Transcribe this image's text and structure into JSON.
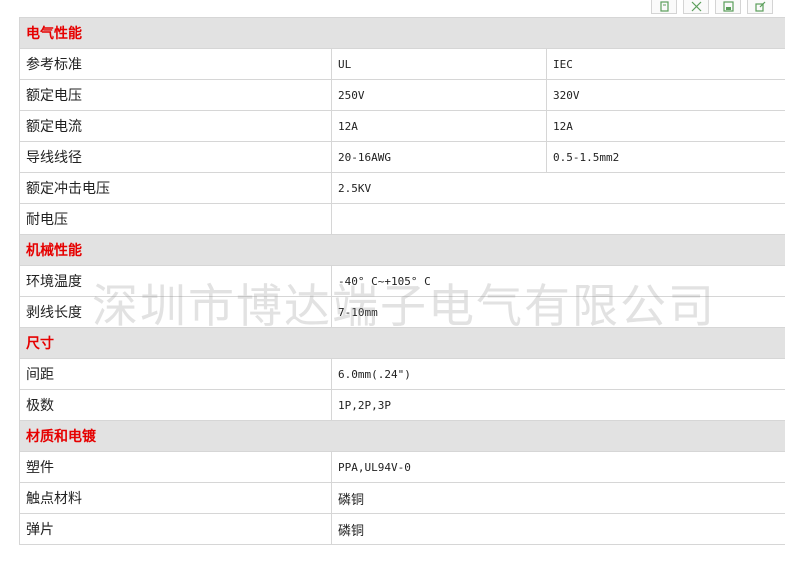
{
  "colors": {
    "section_text": "#e60000",
    "section_bg": "#e2e2e2",
    "border": "#d6d6d6"
  },
  "toolbar": {
    "icons": [
      "copy-icon",
      "expand-icon",
      "save-icon",
      "export-icon"
    ]
  },
  "table": {
    "sections": [
      {
        "title": "电气性能",
        "rows": [
          {
            "label": "参考标准",
            "values": [
              "UL",
              "IEC"
            ]
          },
          {
            "label": "额定电压",
            "values": [
              "250V",
              "320V"
            ]
          },
          {
            "label": "额定电流",
            "values": [
              "12A",
              "12A"
            ]
          },
          {
            "label": "导线线径",
            "values": [
              "20-16AWG",
              "0.5-1.5mm2"
            ]
          },
          {
            "label": "额定冲击电压",
            "values": [
              "2.5KV"
            ]
          },
          {
            "label": "耐电压",
            "values": [
              ""
            ]
          }
        ]
      },
      {
        "title": "机械性能",
        "rows": [
          {
            "label": "环境温度",
            "values": [
              "-40° C~+105° C"
            ]
          },
          {
            "label": "剥线长度",
            "values": [
              "7-10mm"
            ]
          }
        ]
      },
      {
        "title": "尺寸",
        "rows": [
          {
            "label": "间距",
            "values": [
              "6.0mm(.24\")"
            ]
          },
          {
            "label": "极数",
            "values": [
              "1P,2P,3P"
            ]
          }
        ]
      },
      {
        "title": "材质和电镀",
        "rows": [
          {
            "label": "塑件",
            "values": [
              "PPA,UL94V-0"
            ]
          },
          {
            "label": "触点材料",
            "values": [
              "磷铜"
            ]
          },
          {
            "label": "弹片",
            "values": [
              "磷铜"
            ]
          }
        ]
      }
    ]
  },
  "watermark": {
    "text": "深圳市博达端子电气有限公司"
  }
}
